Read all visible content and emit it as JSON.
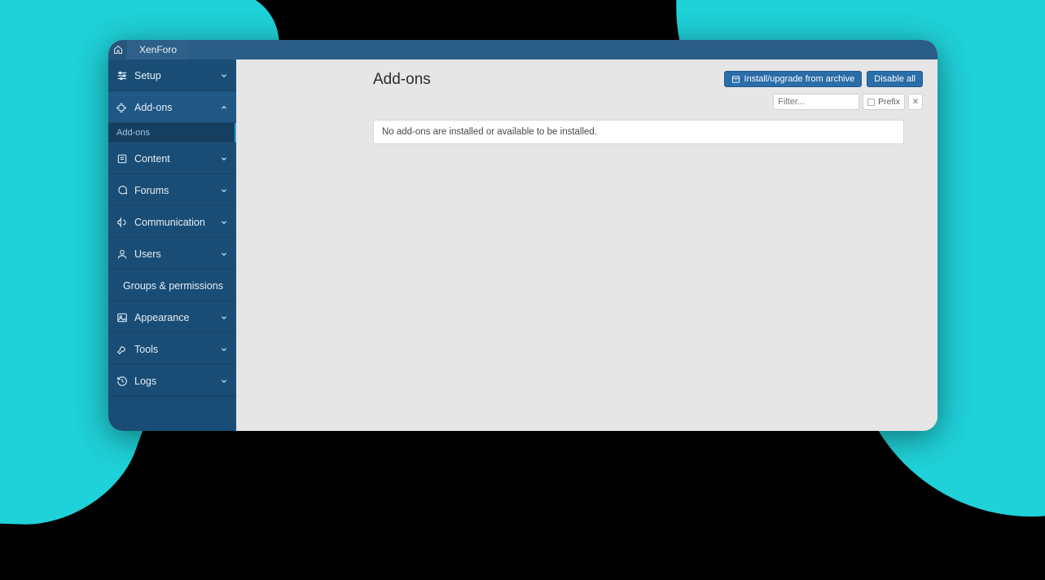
{
  "topbar": {
    "tab_label": "XenForo"
  },
  "sidebar": {
    "items": [
      {
        "label": "Setup",
        "icon": "sliders-icon",
        "expanded": false
      },
      {
        "label": "Add-ons",
        "icon": "puzzle-icon",
        "expanded": true,
        "sub": [
          {
            "label": "Add-ons"
          }
        ]
      },
      {
        "label": "Content",
        "icon": "note-icon",
        "expanded": false
      },
      {
        "label": "Forums",
        "icon": "chat-icon",
        "expanded": false
      },
      {
        "label": "Communication",
        "icon": "megaphone-icon",
        "expanded": false
      },
      {
        "label": "Users",
        "icon": "user-icon",
        "expanded": false
      },
      {
        "label": "Groups & permissions",
        "icon": "users-icon",
        "expanded": false
      },
      {
        "label": "Appearance",
        "icon": "image-icon",
        "expanded": false
      },
      {
        "label": "Tools",
        "icon": "wrench-icon",
        "expanded": false
      },
      {
        "label": "Logs",
        "icon": "history-icon",
        "expanded": false
      }
    ]
  },
  "page": {
    "title": "Add-ons",
    "install_button": "Install/upgrade from archive",
    "disable_button": "Disable all",
    "filter_placeholder": "Filter...",
    "prefix_label": "Prefix",
    "empty_message": "No add-ons are installed or available to be installed."
  }
}
